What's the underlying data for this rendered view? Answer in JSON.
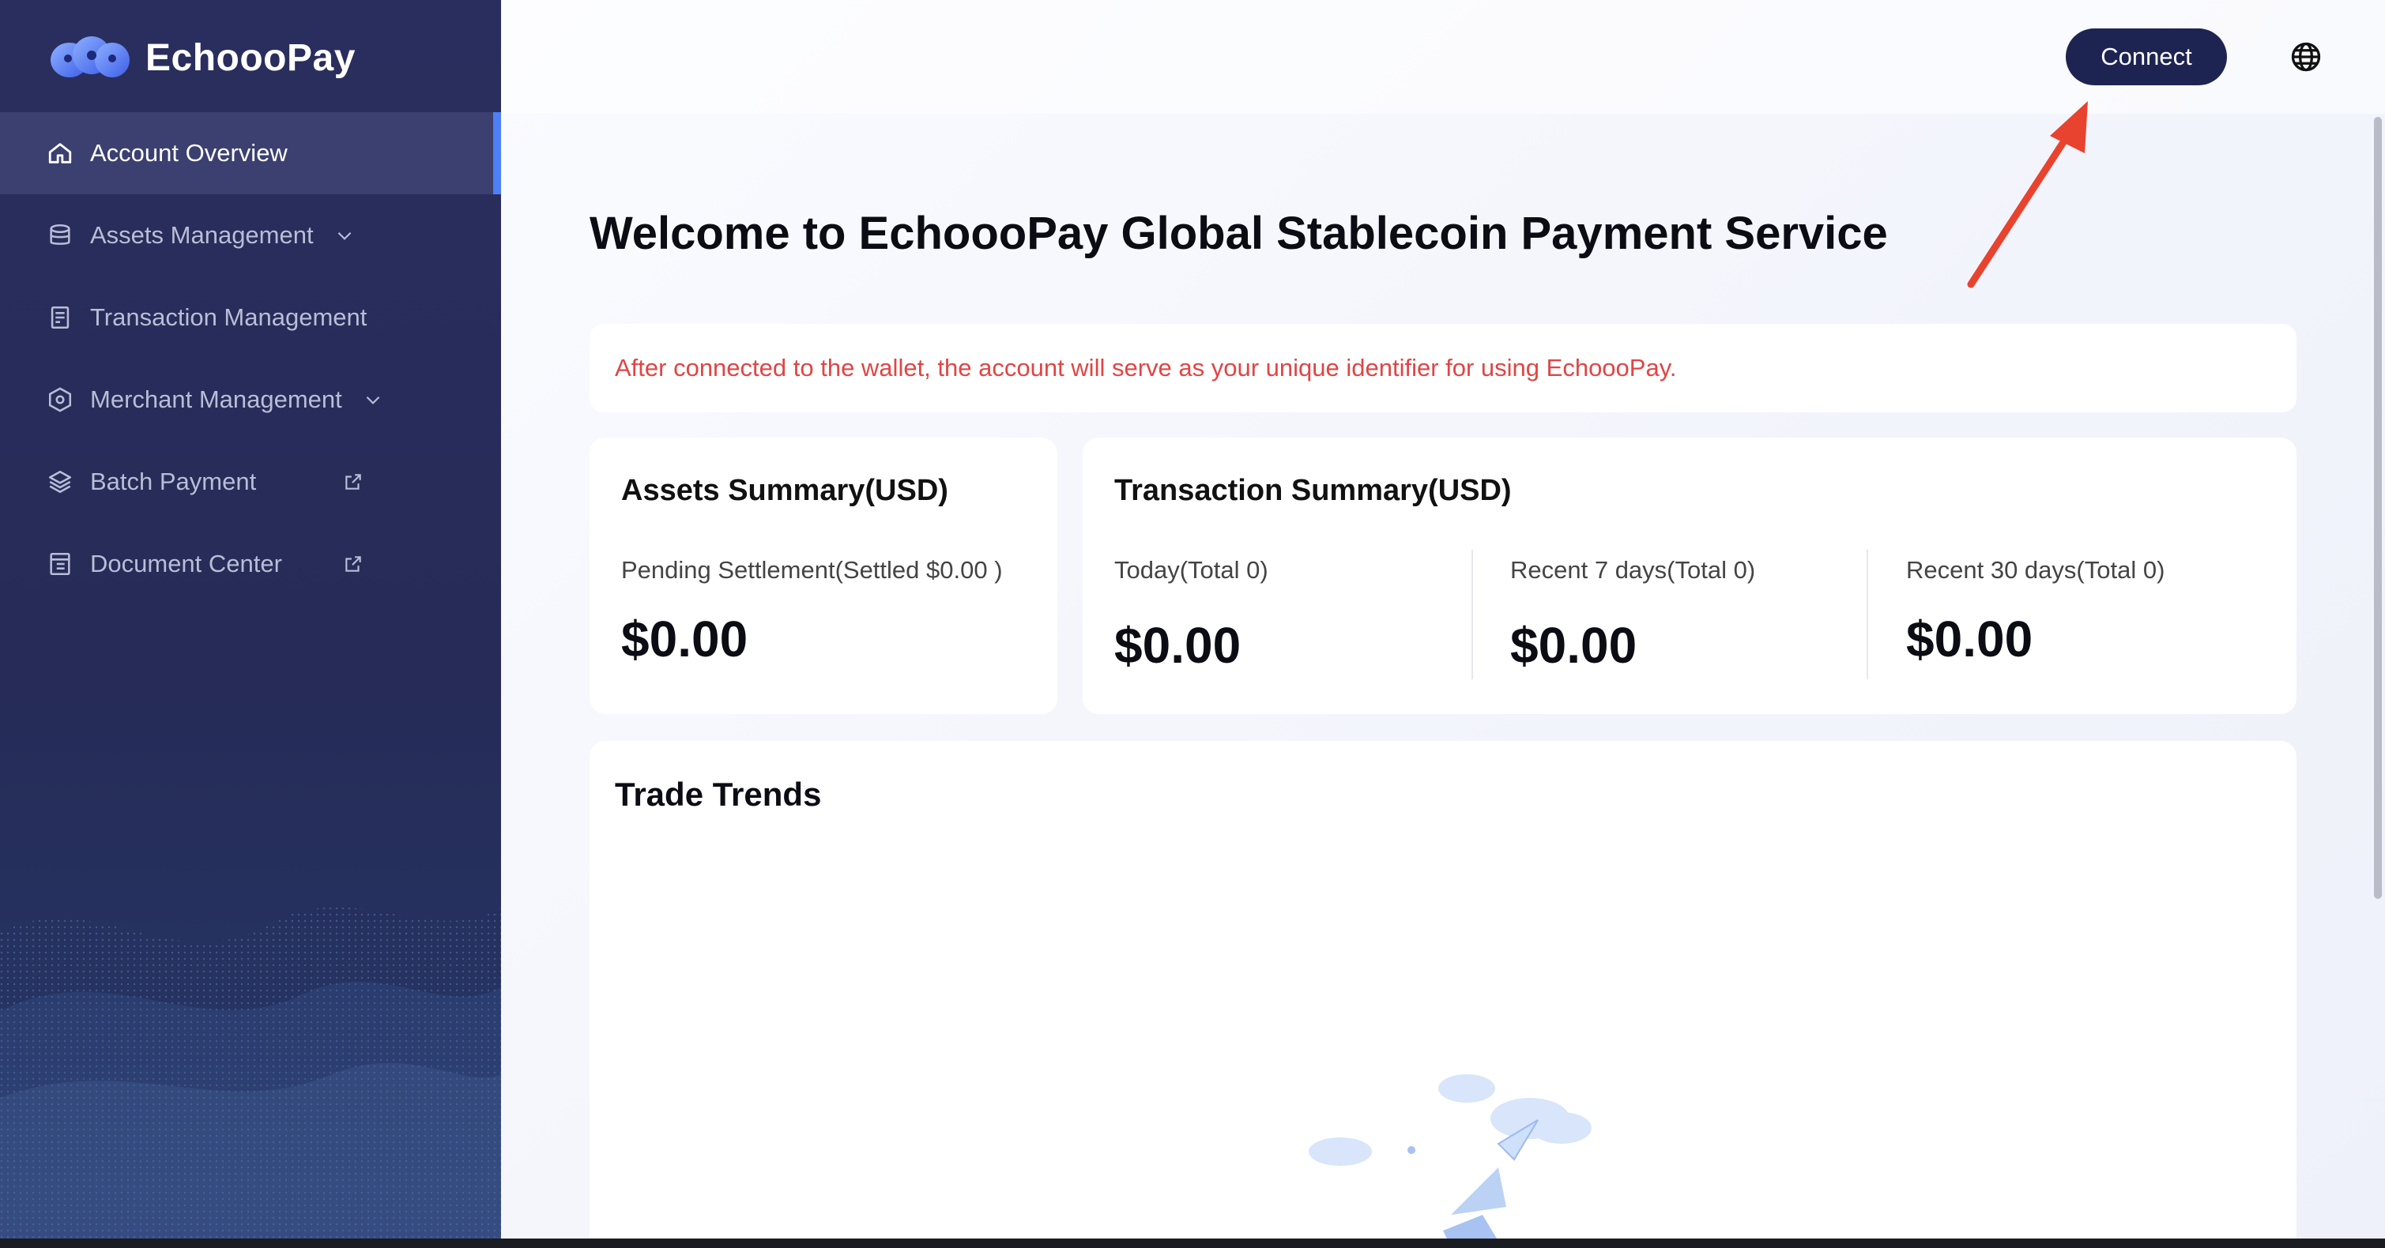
{
  "app": {
    "name": "EchoooPay",
    "brand_color": "#1e2451",
    "accent_color": "#4d7ff5",
    "alert_color": "#e04545"
  },
  "sidebar": {
    "items": [
      {
        "label": "Account Overview",
        "icon": "home-icon",
        "active": true
      },
      {
        "label": "Assets Management",
        "icon": "database-icon",
        "trailing": "chevron-down-icon"
      },
      {
        "label": "Transaction Management",
        "icon": "document-icon"
      },
      {
        "label": "Merchant Management",
        "icon": "hexagon-icon",
        "trailing": "chevron-down-icon"
      },
      {
        "label": "Batch Payment",
        "icon": "layers-icon",
        "trailing": "external-link-icon"
      },
      {
        "label": "Document Center",
        "icon": "file-icon",
        "trailing": "external-link-icon"
      }
    ]
  },
  "header": {
    "connect_label": "Connect",
    "language_icon": "globe-icon"
  },
  "main": {
    "title": "Welcome to EchoooPay Global Stablecoin Payment Service",
    "notice": "After connected to the wallet, the account will serve as your unique identifier for using EchoooPay.",
    "assets_summary": {
      "title": "Assets Summary(USD)",
      "label": "Pending Settlement(Settled $0.00 )",
      "value": "$0.00"
    },
    "transaction_summary": {
      "title": "Transaction Summary(USD)",
      "stats": [
        {
          "label": "Today(Total 0)",
          "value": "$0.00"
        },
        {
          "label": "Recent 7 days(Total 0)",
          "value": "$0.00"
        },
        {
          "label": "Recent 30 days(Total 0)",
          "value": "$0.00"
        }
      ]
    },
    "trade_trends": {
      "title": "Trade Trends"
    }
  }
}
